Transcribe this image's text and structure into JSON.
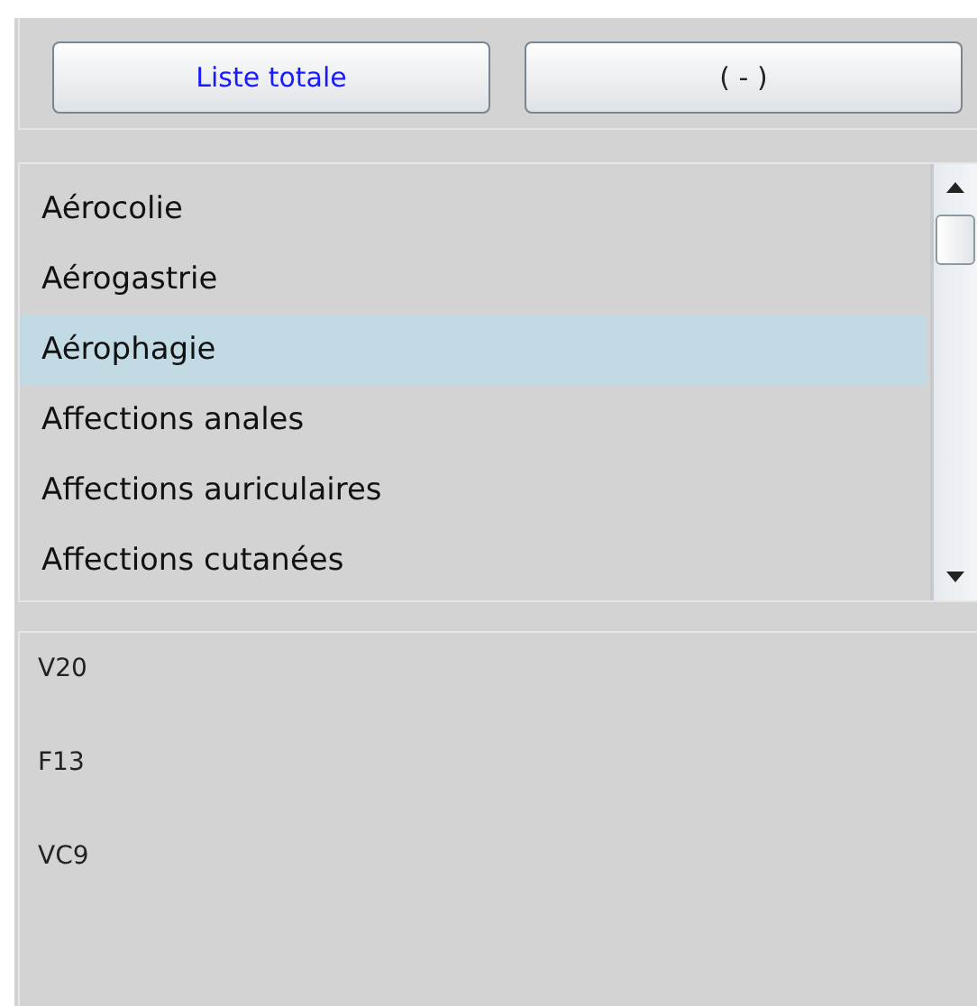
{
  "buttons": [
    {
      "label": "Liste totale",
      "color": "#1a1aff"
    },
    {
      "label": "( - )",
      "color": "#222222"
    }
  ],
  "list": {
    "items": [
      {
        "label": "Aérocolie",
        "selected": false
      },
      {
        "label": "Aérogastrie",
        "selected": false
      },
      {
        "label": "Aérophagie",
        "selected": true
      },
      {
        "label": "Affections anales",
        "selected": false
      },
      {
        "label": "Affections auriculaires",
        "selected": false
      },
      {
        "label": "Affections cutanées",
        "selected": false
      }
    ]
  },
  "codes": [
    "V20",
    "F13",
    "VC9"
  ]
}
